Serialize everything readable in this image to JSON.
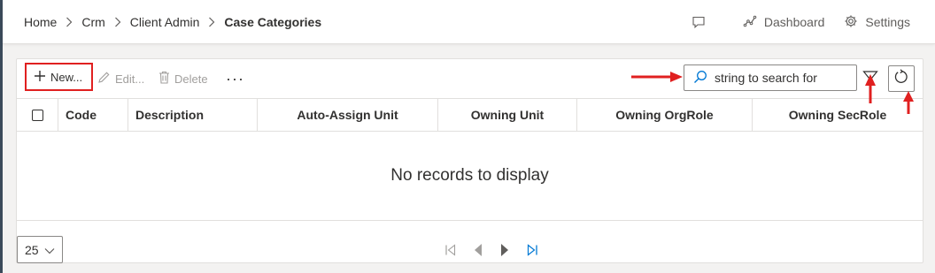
{
  "breadcrumb": {
    "items": [
      "Home",
      "Crm",
      "Client Admin",
      "Case Categories"
    ]
  },
  "header_actions": {
    "dashboard_label": "Dashboard",
    "settings_label": "Settings"
  },
  "toolbar": {
    "new_label": "New...",
    "edit_label": "Edit...",
    "delete_label": "Delete",
    "more_label": "···"
  },
  "search": {
    "placeholder": "string to search for"
  },
  "table": {
    "columns": [
      "Code",
      "Description",
      "Auto-Assign Unit",
      "Owning Unit",
      "Owning OrgRole",
      "Owning SecRole"
    ],
    "empty_message": "No records to display"
  },
  "pagination": {
    "page_size": "25"
  },
  "colors": {
    "annotation_red": "#e02020",
    "accent_blue": "#0078d4",
    "border": "#e1dfdd"
  },
  "icons": [
    "chat-icon",
    "dashboard-icon",
    "gear-icon",
    "plus-icon",
    "pencil-icon",
    "trash-icon",
    "search-icon",
    "filter-icon",
    "refresh-icon",
    "first-page-icon",
    "prev-page-icon",
    "next-page-icon",
    "last-page-icon",
    "chevron-down-icon"
  ]
}
